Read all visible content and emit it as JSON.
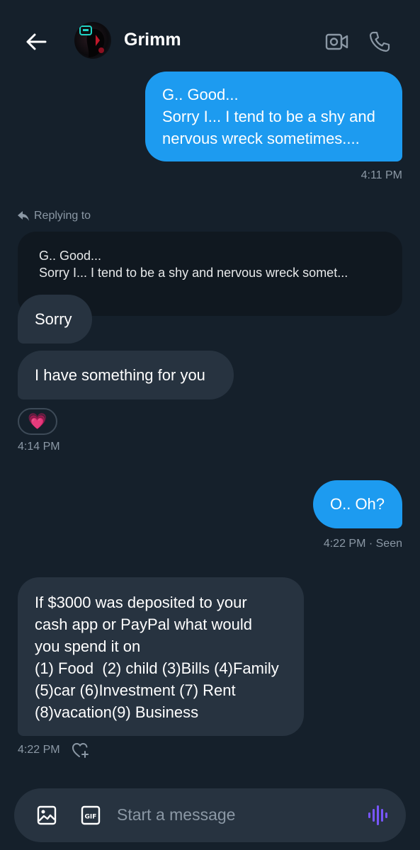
{
  "header": {
    "contact_name": "Grimm"
  },
  "messages": {
    "m1": {
      "lines": [
        "G.. Good...",
        "Sorry I... I tend to be a shy and",
        "nervous wreck sometimes...."
      ],
      "time": "4:11 PM"
    },
    "reply": {
      "label": "Replying to",
      "quote_line1": "G.. Good...",
      "quote_line2": "Sorry I... I tend to be a shy and nervous wreck somet..."
    },
    "m2": {
      "text": "Sorry"
    },
    "m3": {
      "text": "I have something for you"
    },
    "m3_reaction": "💗",
    "m3_time": "4:14 PM",
    "m4": {
      "text": "O.. Oh?",
      "time": "4:22 PM · Seen"
    },
    "m5": {
      "lines": [
        "If $3000 was deposited to your",
        "cash app or PayPal what would",
        "you spend it on",
        "(1) Food  (2) child (3)Bills (4)Family",
        "(5)car (6)Investment (7) Rent",
        "(8)vacation(9) Business"
      ],
      "time": "4:22 PM"
    }
  },
  "composer": {
    "placeholder": "Start a message"
  },
  "icons": {
    "back": "back-arrow-icon",
    "video": "video-call-icon",
    "phone": "phone-call-icon",
    "reply": "reply-arrow-icon",
    "add_reaction": "heart-plus-icon",
    "image": "image-icon",
    "gif": "gif-icon",
    "voice": "voice-wave-icon"
  },
  "colors": {
    "background": "#15202b",
    "outgoing_bubble": "#1d9bf0",
    "incoming_bubble": "#273340",
    "muted_text": "#8b98a5",
    "voice_accent": "#7856ff"
  }
}
